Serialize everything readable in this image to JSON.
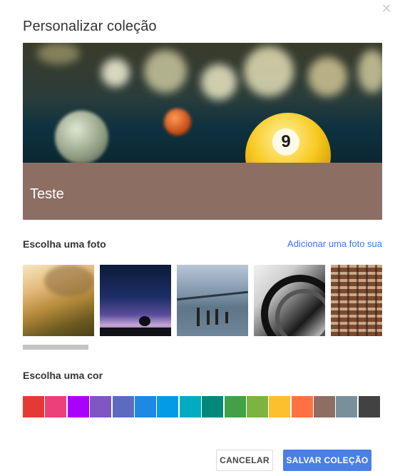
{
  "dialog": {
    "title": "Personalizar coleção",
    "close_icon": "close-icon"
  },
  "preview": {
    "title": "Teste",
    "band_color": "#8d6e63",
    "ball_number": "9"
  },
  "photos": {
    "label": "Escolha uma foto",
    "add_link": "Adicionar uma foto sua",
    "items": [
      "path-sunset-photo",
      "night-sky-photo",
      "bridge-pier-photo",
      "architecture-curves-photo",
      "warehouse-ceiling-photo"
    ]
  },
  "colors": {
    "label": "Escolha uma cor",
    "swatches": [
      "#e53935",
      "#ec407a",
      "#aa00ff",
      "#7e57c2",
      "#5c6bc0",
      "#1e88e5",
      "#039be5",
      "#00acc1",
      "#00897b",
      "#43a047",
      "#7cb342",
      "#fbc02d",
      "#ff7043",
      "#8d6e63",
      "#78909c",
      "#424242"
    ]
  },
  "buttons": {
    "cancel": "CANCELAR",
    "save": "SALVAR COLEÇÃO"
  }
}
